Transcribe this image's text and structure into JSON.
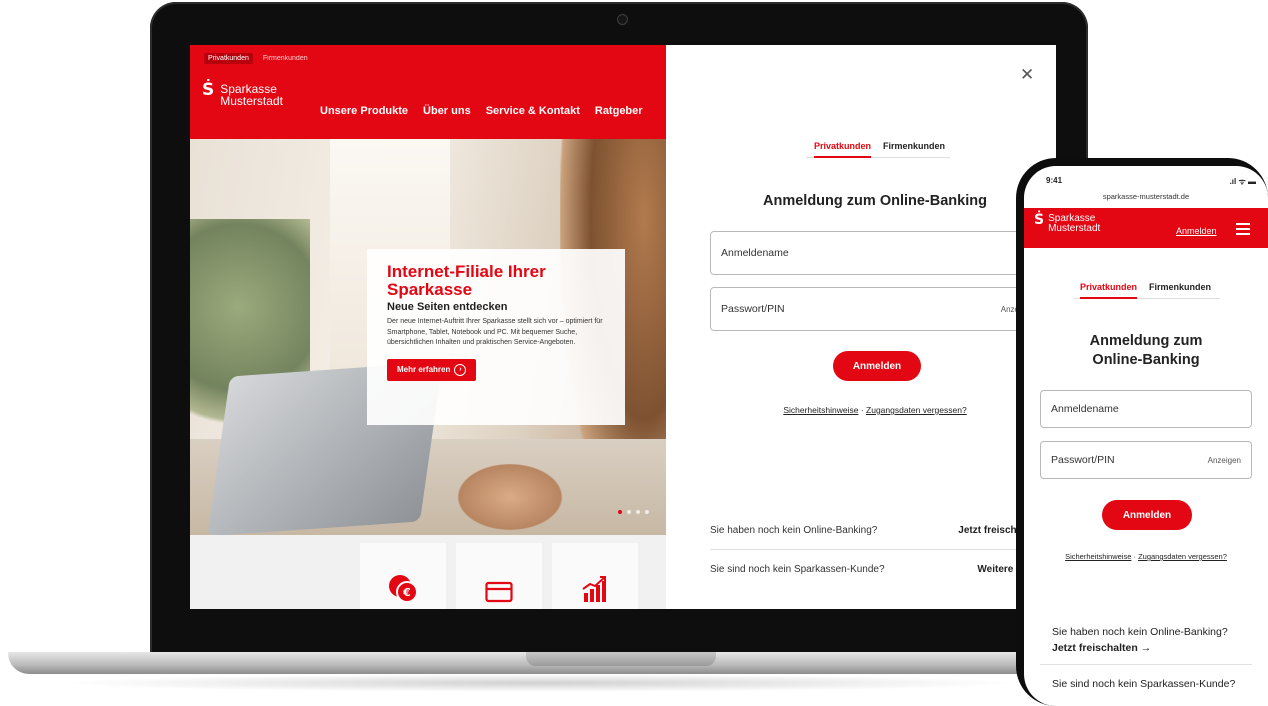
{
  "colors": {
    "brand_red": "#e30613",
    "text": "#222222",
    "border": "#b9b9b9"
  },
  "website": {
    "segment_tabs": [
      "Privatkunden",
      "Firmenkunden"
    ],
    "logo": {
      "line1": "Sparkasse",
      "line2": "Musterstadt"
    },
    "nav": [
      "Unsere Produkte",
      "Über uns",
      "Service & Kontakt",
      "Ratgeber"
    ],
    "teaser": {
      "title": "Internet-Filiale Ihrer Sparkasse",
      "subtitle": "Neue Seiten entdecken",
      "text": "Der neue Internet-Auftritt Ihrer Sparkasse stellt sich vor – optimiert für Smartphone, Tablet, Notebook und PC. Mit bequemer Suche, übersichtlichen Inhalten und praktischen Service-Angeboten.",
      "button": "Mehr erfahren"
    },
    "feature_icons": [
      "coins-euro-icon",
      "credit-card-icon",
      "growth-chart-icon"
    ]
  },
  "login": {
    "tabs": [
      "Privatkunden",
      "Firmenkunden"
    ],
    "heading": "Anmeldung zum Online-Banking",
    "username_placeholder": "Anmeldename",
    "password_placeholder": "Passwort/PIN",
    "show_password_truncated": "Anze",
    "submit": "Anmelden",
    "security_link": "Sicherheitshinweise",
    "separator": "·",
    "forgot_link": "Zugangsdaten vergessen?",
    "promo_rows": [
      {
        "question": "Sie haben noch kein Online-Banking?",
        "action": "Jetzt freischalten"
      },
      {
        "question": "Sie sind noch kein Sparkassen-Kunde?",
        "action": "Weitere Infos"
      }
    ]
  },
  "phone": {
    "time": "9:41",
    "signal": ".ıl ᯤ ▬",
    "url": "sparkasse-musterstadt.de",
    "logo": {
      "line1": "Sparkasse",
      "line2": "Musterstadt"
    },
    "login_link": "Anmelden",
    "tabs": [
      "Privatkunden",
      "Firmenkunden"
    ],
    "heading_line1": "Anmeldung zum",
    "heading_line2": "Online-Banking",
    "username_placeholder": "Anmeldename",
    "password_placeholder": "Passwort/PIN",
    "show_password": "Anzeigen",
    "submit": "Anmelden",
    "security_link": "Sicherheitshinweise",
    "separator": "·",
    "forgot_link": "Zugangsdaten vergessen?",
    "promo1_question": "Sie haben noch kein Online-Banking?",
    "promo1_action": "Jetzt freischalten →",
    "promo2_question": "Sie sind noch kein Sparkassen-Kunde?"
  }
}
